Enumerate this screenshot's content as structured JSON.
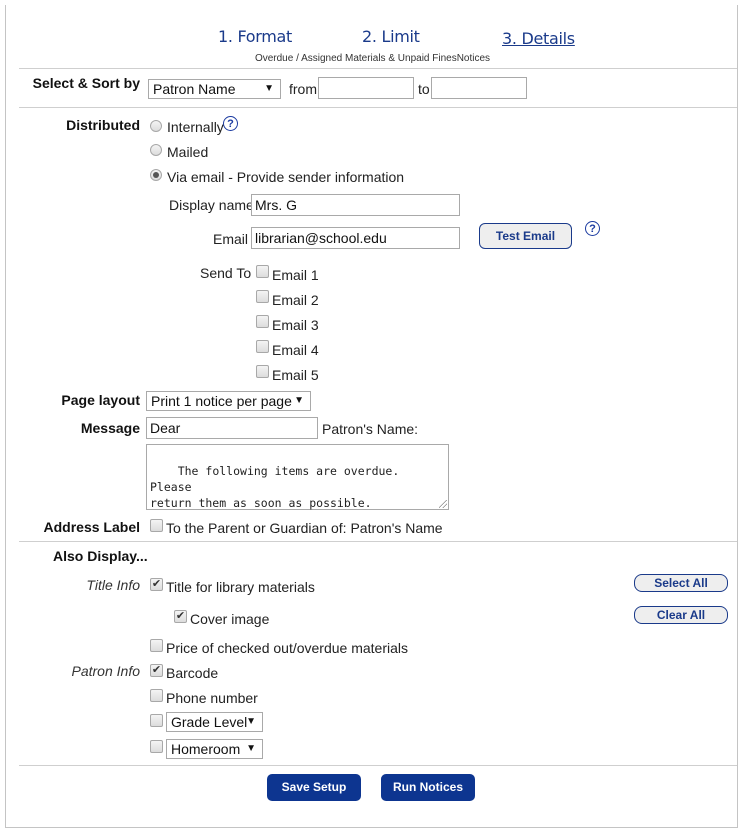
{
  "wizard": {
    "steps": [
      {
        "label": "1. Format",
        "active": false
      },
      {
        "label": "2. Limit",
        "active": false
      },
      {
        "label": "3. Details",
        "active": true
      }
    ],
    "subtitle": "Overdue / Assigned Materials & Unpaid FinesNotices"
  },
  "select_sort": {
    "label": "Select & Sort by",
    "selected": "Patron Name",
    "from_label": "from",
    "from_value": "",
    "to_label": "to",
    "to_value": ""
  },
  "distributed": {
    "label": "Distributed",
    "options": [
      {
        "label": "Internally",
        "selected": false
      },
      {
        "label": "Mailed",
        "selected": false
      },
      {
        "label": "Via email - Provide sender information",
        "selected": true
      }
    ],
    "help_icon": "?"
  },
  "sender": {
    "display_name_label": "Display name",
    "display_name_value": "Mrs. G",
    "email_label": "Email",
    "email_value": "librarian@school.edu",
    "test_email_button": "Test Email",
    "help_icon": "?"
  },
  "send_to": {
    "label": "Send To",
    "options": [
      {
        "label": "Email 1",
        "checked": false
      },
      {
        "label": "Email 2",
        "checked": false
      },
      {
        "label": "Email 3",
        "checked": false
      },
      {
        "label": "Email 4",
        "checked": false
      },
      {
        "label": "Email 5",
        "checked": false
      }
    ]
  },
  "page_layout": {
    "label": "Page layout",
    "selected": "Print 1 notice per page"
  },
  "message": {
    "label": "Message",
    "greeting_value": "Dear",
    "greeting_suffix": "Patron's Name:",
    "body": "The following items are overdue. Please\nreturn them as soon as possible."
  },
  "address_label": {
    "label": "Address Label",
    "option": "To the Parent or Guardian of: Patron's Name",
    "checked": false
  },
  "also_display": {
    "heading": "Also Display...",
    "title_info_label": "Title Info",
    "title_info": [
      {
        "label": "Title for library materials",
        "checked": true
      },
      {
        "label": "Cover image",
        "checked": true
      },
      {
        "label": "Price of checked out/overdue materials",
        "checked": false
      }
    ],
    "patron_info_label": "Patron Info",
    "patron_info": [
      {
        "label": "Barcode",
        "checked": true
      },
      {
        "label": "Phone number",
        "checked": false
      }
    ],
    "patron_selects": [
      {
        "selected": "Grade Level",
        "checked": false
      },
      {
        "selected": "Homeroom",
        "checked": false
      }
    ],
    "select_all_button": "Select All",
    "clear_all_button": "Clear All"
  },
  "footer": {
    "save_button": "Save Setup",
    "run_button": "Run Notices"
  },
  "glyphs": {
    "check": "✔",
    "dropdown_arrow": "▼"
  }
}
